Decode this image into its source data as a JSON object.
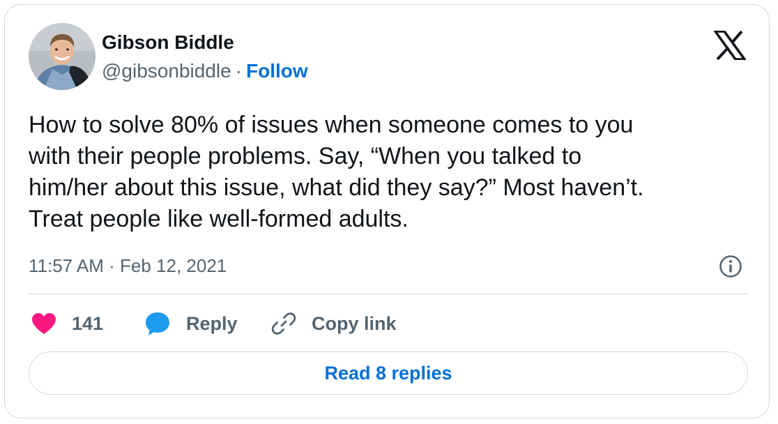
{
  "author": {
    "name": "Gibson Biddle",
    "handle": "@gibsonbiddle",
    "separator": "·",
    "follow_label": "Follow",
    "avatar_icon": "profile-photo"
  },
  "tweet": {
    "text_lines": [
      "How to solve 80% of issues when someone comes to you",
      "with their people problems. Say, “When you talked to",
      "him/her about this issue, what did they say?” Most haven’t.",
      "Treat people like well-formed adults."
    ],
    "timestamp": "11:57 AM · Feb 12, 2021"
  },
  "actions": {
    "like_count": "141",
    "reply_label": "Reply",
    "copy_link_label": "Copy link"
  },
  "footer": {
    "read_replies_label": "Read 8 replies"
  },
  "colors": {
    "heart": "#f91880",
    "reply_bubble": "#1d9bf0",
    "link_blue": "#006fd6",
    "secondary_text": "#536471",
    "border": "#cfd9de"
  },
  "icons": {
    "logo": "x-logo-icon",
    "info": "info-icon",
    "like": "heart-icon",
    "reply": "speech-bubble-icon",
    "copy": "link-icon"
  }
}
